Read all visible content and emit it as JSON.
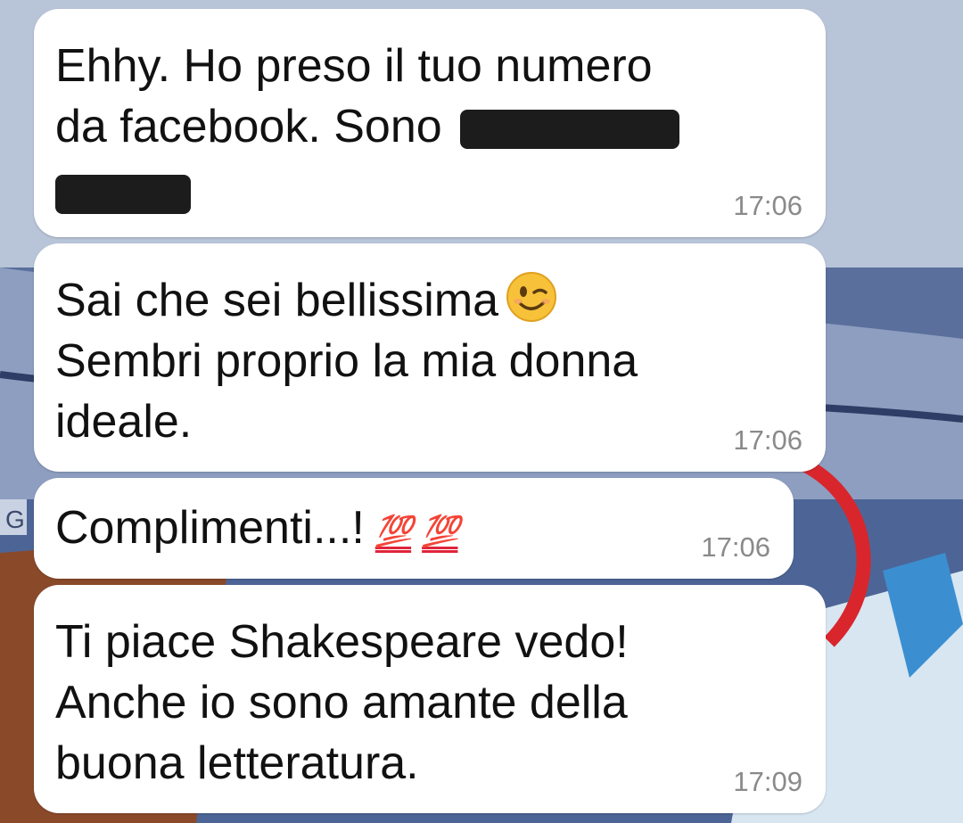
{
  "chat": {
    "messages": [
      {
        "line1": "Ehhy. Ho preso il tuo numero",
        "line2": "da facebook. Sono",
        "time": "17:06"
      },
      {
        "line1": "Sai che sei bellissima",
        "emoji": "winking-face",
        "line2": "Sembri proprio la mia donna",
        "line3": "ideale.",
        "time": "17:06"
      },
      {
        "text": "Complimenti...!",
        "emoji_1": "💯",
        "emoji_2": "💯",
        "time": "17:06"
      },
      {
        "line1": "Ti piace Shakespeare vedo!",
        "line2": "Anche io sono amante della",
        "line3": "buona letteratura.",
        "time": "17:09"
      }
    ]
  },
  "colors": {
    "bubble": "#ffffff",
    "timestamp": "#8a8a8a",
    "redaction": "#1c1c1c",
    "emoji_100": "#e0253a"
  }
}
